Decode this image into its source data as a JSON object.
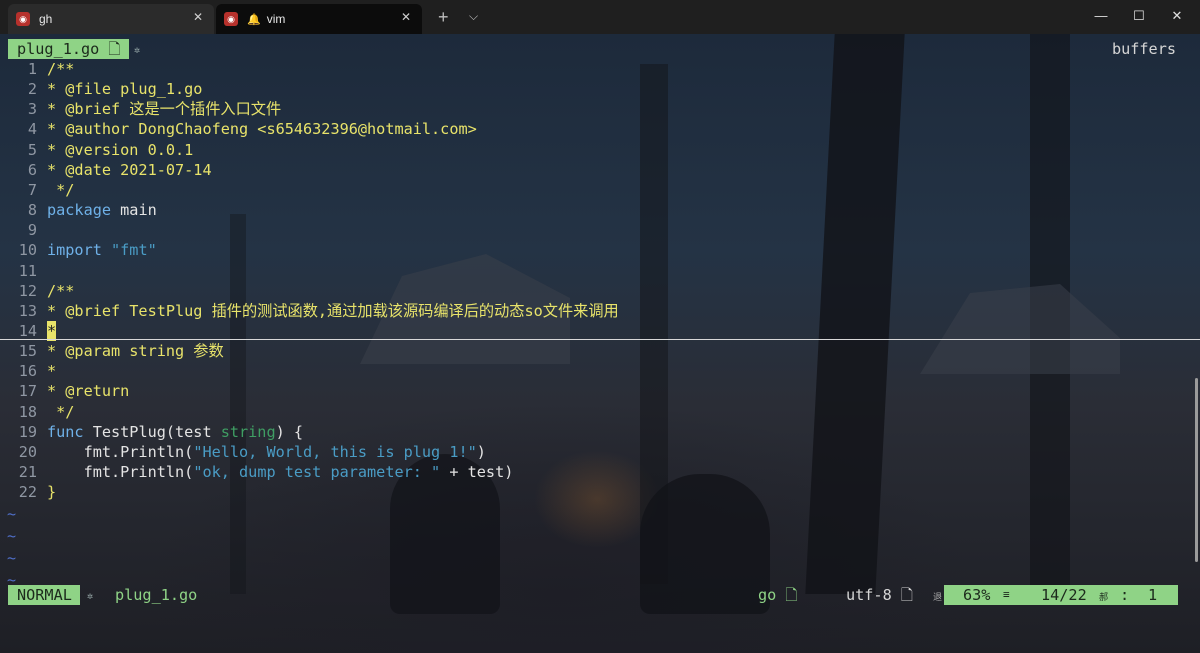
{
  "window": {
    "tabs": [
      {
        "label": "gh",
        "icon": "ubuntu-app-icon"
      },
      {
        "label": "vim",
        "icon": "ubuntu-app-icon"
      }
    ],
    "new_tab_glyph": "+",
    "dropdown_glyph": "⌵",
    "minimize_glyph": "—",
    "maximize_glyph": "☐",
    "close_glyph": "✕",
    "tab_close_glyph": "✕",
    "bell_glyph": "🔔"
  },
  "tabline": {
    "file": "plug_1.go 🗋",
    "buffers_label": "buffers"
  },
  "editor": {
    "lines": [
      {
        "n": "1",
        "text": "/**"
      },
      {
        "n": "2",
        "text": "* @file plug_1.go"
      },
      {
        "n": "3",
        "text": "* @brief 这是一个插件入口文件"
      },
      {
        "n": "4",
        "text": "* @author DongChaofeng <s654632396@hotmail.com>"
      },
      {
        "n": "5",
        "text": "* @version 0.0.1"
      },
      {
        "n": "6",
        "text": "* @date 2021-07-14"
      },
      {
        "n": "7",
        "text": " */"
      },
      {
        "n": "8",
        "kw": "package",
        "rest": " main"
      },
      {
        "n": "9",
        "text": ""
      },
      {
        "n": "10",
        "kw": "import",
        "str": " \"fmt\""
      },
      {
        "n": "11",
        "text": ""
      },
      {
        "n": "12",
        "text": "/**"
      },
      {
        "n": "13",
        "text": "* @brief TestPlug 插件的测试函数,通过加载该源码编译后的动态so文件来调用"
      },
      {
        "n": "14",
        "text": "*"
      },
      {
        "n": "15",
        "text": "* @param string 参数"
      },
      {
        "n": "16",
        "text": "*"
      },
      {
        "n": "17",
        "text": "* @return"
      },
      {
        "n": "18",
        "text": " */"
      },
      {
        "n": "19",
        "kw": "func",
        "a": " TestPlug(test ",
        "typ": "string",
        "b": ") {"
      },
      {
        "n": "20",
        "a": "    fmt.Println(",
        "str": "\"Hello, World, this is plug 1!\"",
        "b": ")"
      },
      {
        "n": "21",
        "a": "    fmt.Println(",
        "str": "\"ok, dump test parameter: \"",
        "b": " + test)"
      },
      {
        "n": "22",
        "text": "}"
      }
    ],
    "tildes": [
      "~",
      "~",
      "~",
      "~"
    ]
  },
  "statusline": {
    "mode": "NORMAL",
    "file": "plug_1.go",
    "filetype": "go 🗋",
    "encoding": "utf-8 🗋",
    "cjk_mark": "退",
    "percent": "63%",
    "eq_glyph": "≡",
    "position": "14/22",
    "cjk_mark2": "郝",
    "colon": ":",
    "column": "1"
  },
  "colors": {
    "accent_green": "#8fd386",
    "comment_yellow": "#e8e36a",
    "keyword_blue": "#6fb1e8",
    "string_blue": "#4a9cc5",
    "type_green": "#3f9e63",
    "line_number": "#8f97a3",
    "tilde_blue": "#4f6ec7"
  }
}
